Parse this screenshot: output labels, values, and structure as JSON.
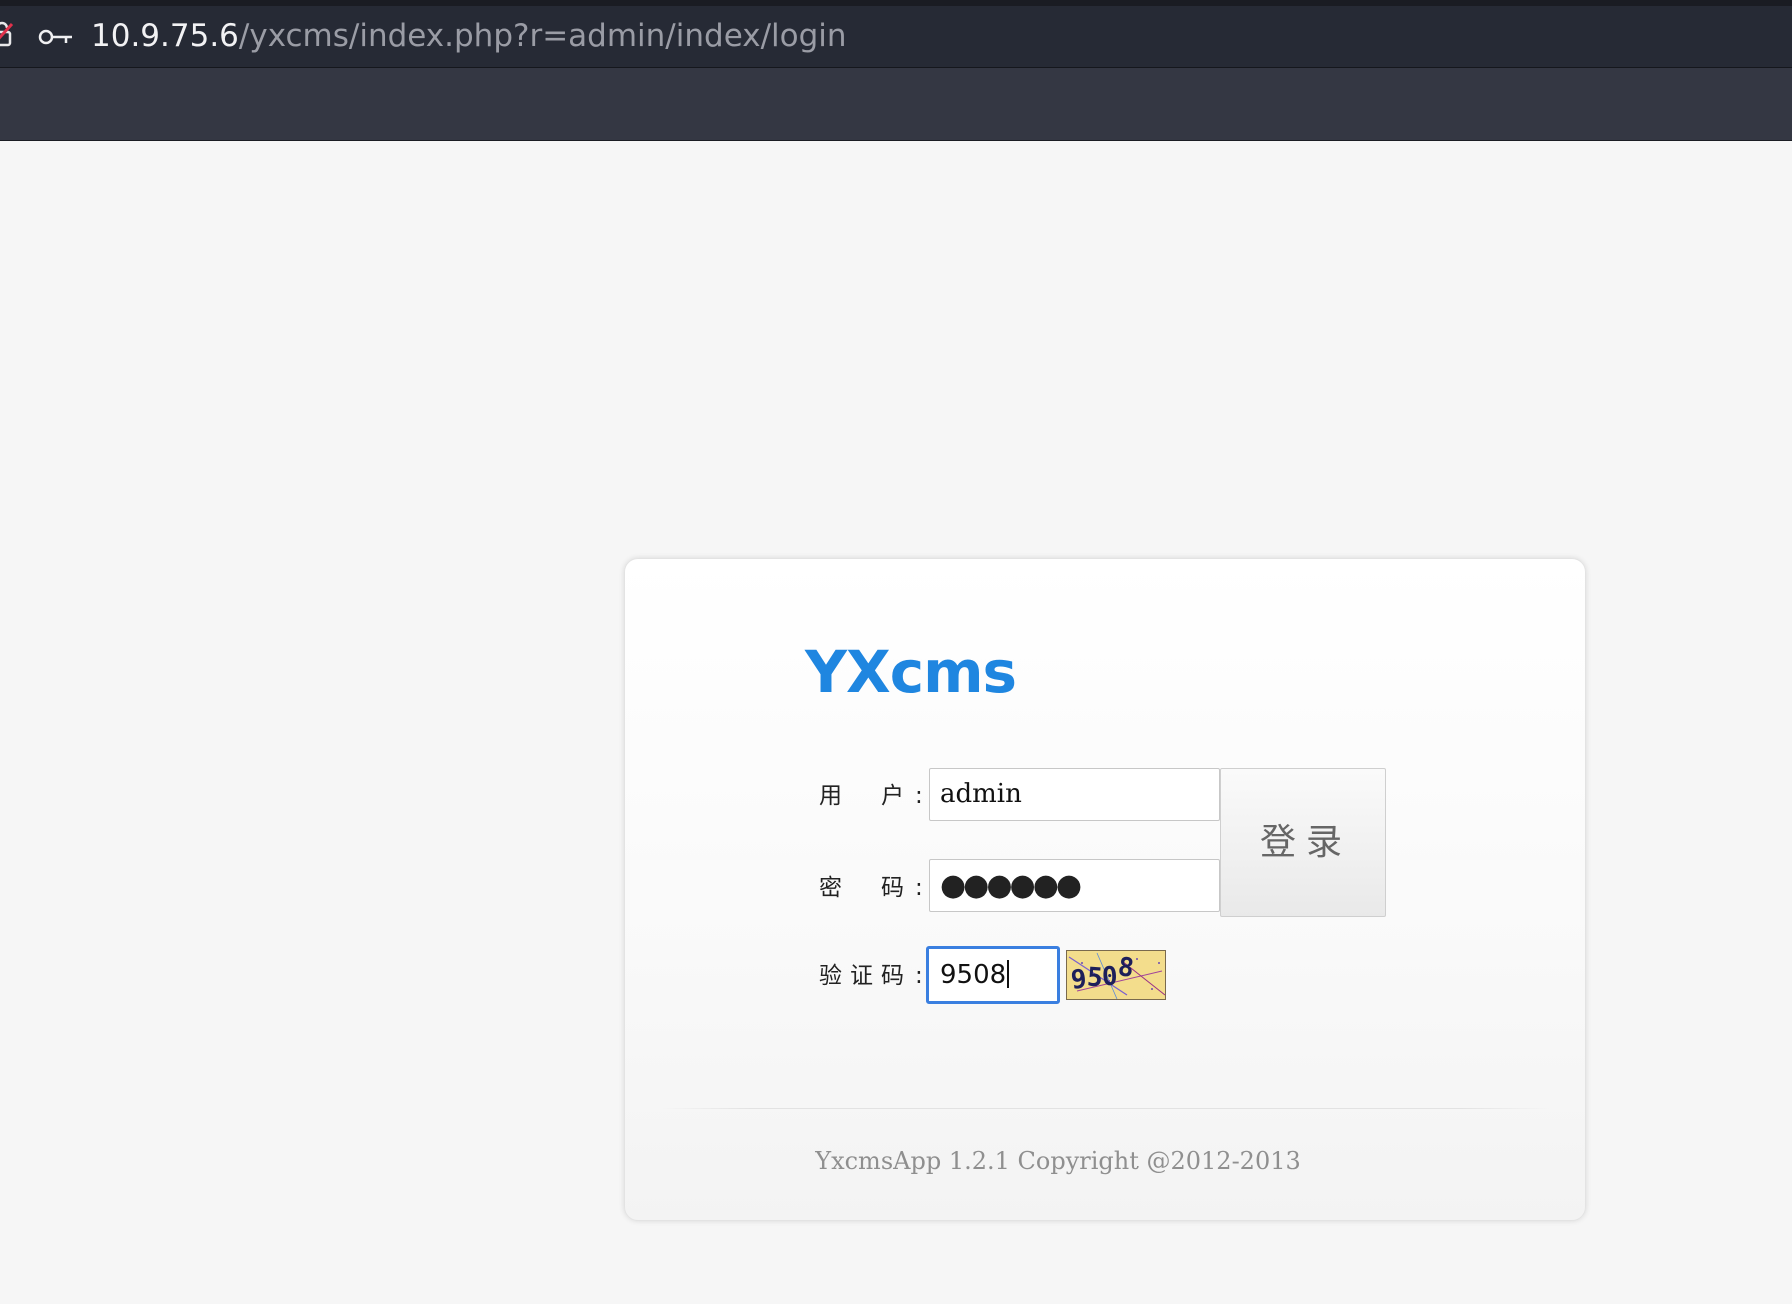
{
  "browser": {
    "url_host": "10.9.75.6",
    "url_path": "/yxcms/index.php?r=admin/index/login"
  },
  "login": {
    "logo": "YXcms",
    "username_label_1": "用",
    "username_label_2": "户",
    "password_label_1": "密",
    "password_label_2": "码",
    "captcha_label_1": "验",
    "captcha_label_2": "证",
    "captcha_label_3": "码",
    "colon": ":",
    "username_value": "admin",
    "password_dots": "●●●●●●",
    "captcha_value": "9508",
    "captcha_image_text": [
      "9",
      "5",
      "0",
      "8"
    ],
    "login_button": "登录",
    "copyright": "YxcmsApp 1.2.1 Copyright @2012-2013"
  },
  "colors": {
    "logo_blue": "#1f86e0",
    "focus_blue": "#3a7fe0",
    "chrome_dark": "#262a35",
    "toolbar": "#343743"
  }
}
